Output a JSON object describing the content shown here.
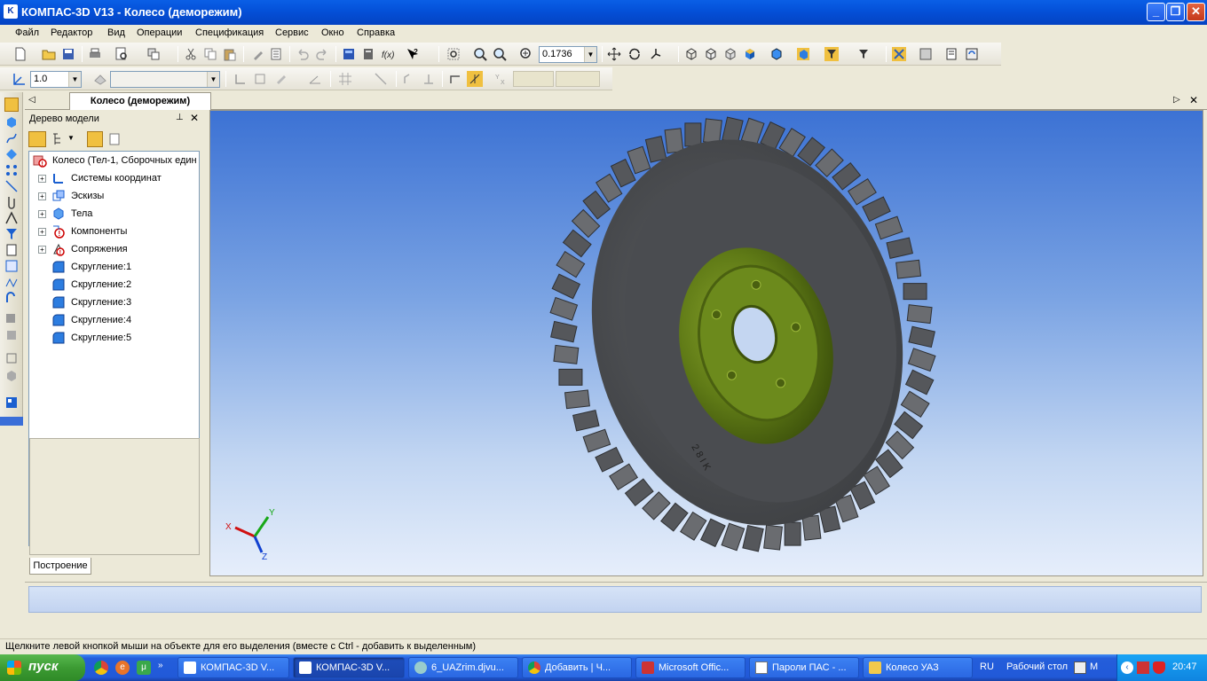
{
  "window": {
    "title": "КОМПАС-3D V13 - Колесо (деморежим)",
    "app_icon": "kompas-logo-icon"
  },
  "menu": [
    "Файл",
    "Редактор",
    "Вид",
    "Операции",
    "Спецификация",
    "Сервис",
    "Окно",
    "Справка"
  ],
  "toolbar": {
    "zoom_value": "0.1736",
    "line_value": "1.0"
  },
  "doc_tab": {
    "label": "Колесо (деморежим)"
  },
  "tree": {
    "title": "Дерево модели",
    "root": "Колесо (Тел-1, Сборочных един",
    "items": [
      "Системы координат",
      "Эскизы",
      "Тела",
      "Компоненты",
      "Сопряжения",
      "Скругление:1",
      "Скругление:2",
      "Скругление:3",
      "Скругление:4",
      "Скругление:5"
    ],
    "bottom_tab": "Построение"
  },
  "axes": {
    "x": "X",
    "y": "Y",
    "z": "Z"
  },
  "colors": {
    "rim": "#6b8a1c",
    "tire": "#55575a",
    "viewport_top": "#3c72d4"
  },
  "status": {
    "text": "Щелкните левой кнопкой мыши на объекте для его выделения (вместе с Ctrl - добавить к выделенным)"
  },
  "taskbar": {
    "start": "пуск",
    "tasks": [
      "КОМПАС-3D V...",
      "КОМПАС-3D V...",
      "6_UAZrim.djvu...",
      "Добавить | Ч...",
      "Microsoft Offic...",
      "Пароли ПАС - ...",
      "Колесо УАЗ"
    ],
    "lang": "RU",
    "desktop": "Рабочий стол",
    "extra": "M",
    "clock": "20:47"
  }
}
